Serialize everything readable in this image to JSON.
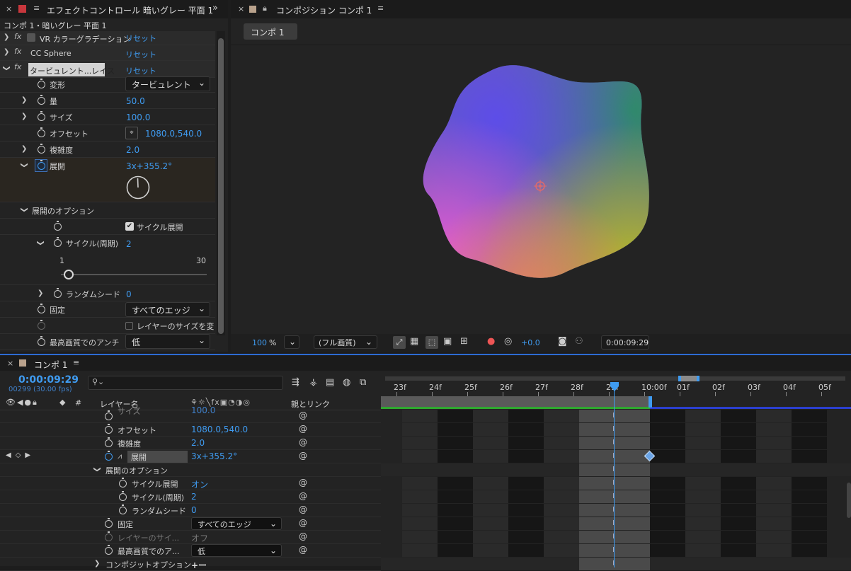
{
  "effect_panel": {
    "tab_title": "エフェクトコントロール 暗いグレー 平面 1",
    "breadcrumb": "コンポ 1・暗いグレー 平面 1",
    "effects": [
      {
        "name": "VR カラーグラデーション",
        "reset": "リセット"
      },
      {
        "name": "CC Sphere",
        "reset": "リセット"
      },
      {
        "name": "タービュレント...レイス",
        "reset": "リセット"
      }
    ],
    "props": {
      "henkei": {
        "label": "変形",
        "value": "タービュレント"
      },
      "ryo": {
        "label": "量",
        "value": "50.0"
      },
      "size": {
        "label": "サイズ",
        "value": "100.0"
      },
      "offset": {
        "label": "オフセット",
        "value": "1080.0,540.0"
      },
      "complexity": {
        "label": "複雑度",
        "value": "2.0"
      },
      "evolution": {
        "label": "展開",
        "value": "3x+355.2°"
      },
      "evo_options": {
        "label": "展開のオプション"
      },
      "cycle_evo": {
        "label": "サイクル展開",
        "checked": true
      },
      "cycle": {
        "label": "サイクル(周期)",
        "value": "2",
        "min": "1",
        "max": "30",
        "slider_fraction": 0.035
      },
      "random_seed": {
        "label": "ランダムシード",
        "value": "0"
      },
      "pin": {
        "label": "固定",
        "value": "すべてのエッジ"
      },
      "layer_size": {
        "label": "レイヤーのサイズを変"
      },
      "quality": {
        "label": "最高画質でのアンチ",
        "value": "低"
      }
    }
  },
  "comp_panel": {
    "tab_title": "コンポジション コンポ 1",
    "comp_button": "コンポ 1",
    "zoom": "100",
    "zoom_unit": "%",
    "resolution": "(フル画質)",
    "exposure": "+0.0",
    "timecode": "0:00:09:29"
  },
  "timeline": {
    "tab_title": "コンポ 1",
    "timecode": "0:00:09:29",
    "frames": "00299 (30.00 fps)",
    "search_placeholder": "",
    "col_layer": "レイヤー名",
    "col_parent": "親とリンク",
    "ruler": [
      "23f",
      "24f",
      "25f",
      "26f",
      "27f",
      "28f",
      "29f",
      "10:00f",
      "01f",
      "02f",
      "03f",
      "04f",
      "05f"
    ],
    "rows": [
      {
        "label": "サイズ",
        "value": "100.0"
      },
      {
        "label": "オフセット",
        "value": "1080.0,540.0"
      },
      {
        "label": "複雑度",
        "value": "2.0"
      },
      {
        "label": "展開",
        "value": "3x+355.2°"
      },
      {
        "label": "展開のオプション",
        "value": ""
      },
      {
        "label": "サイクル展開",
        "value": "オン"
      },
      {
        "label": "サイクル(周期)",
        "value": "2"
      },
      {
        "label": "ランダムシード",
        "value": "0"
      },
      {
        "label": "固定",
        "value": "すべてのエッジ"
      },
      {
        "label": "レイヤーのサイ...",
        "value": "オフ"
      },
      {
        "label": "最高画質でのア...",
        "value": "低"
      },
      {
        "label": "コンポジットオプション",
        "value": "+ー"
      }
    ]
  },
  "colors": {
    "accent": "#3f9bf0",
    "panel": "#232323",
    "timeline_border": "#2d6bd3"
  }
}
